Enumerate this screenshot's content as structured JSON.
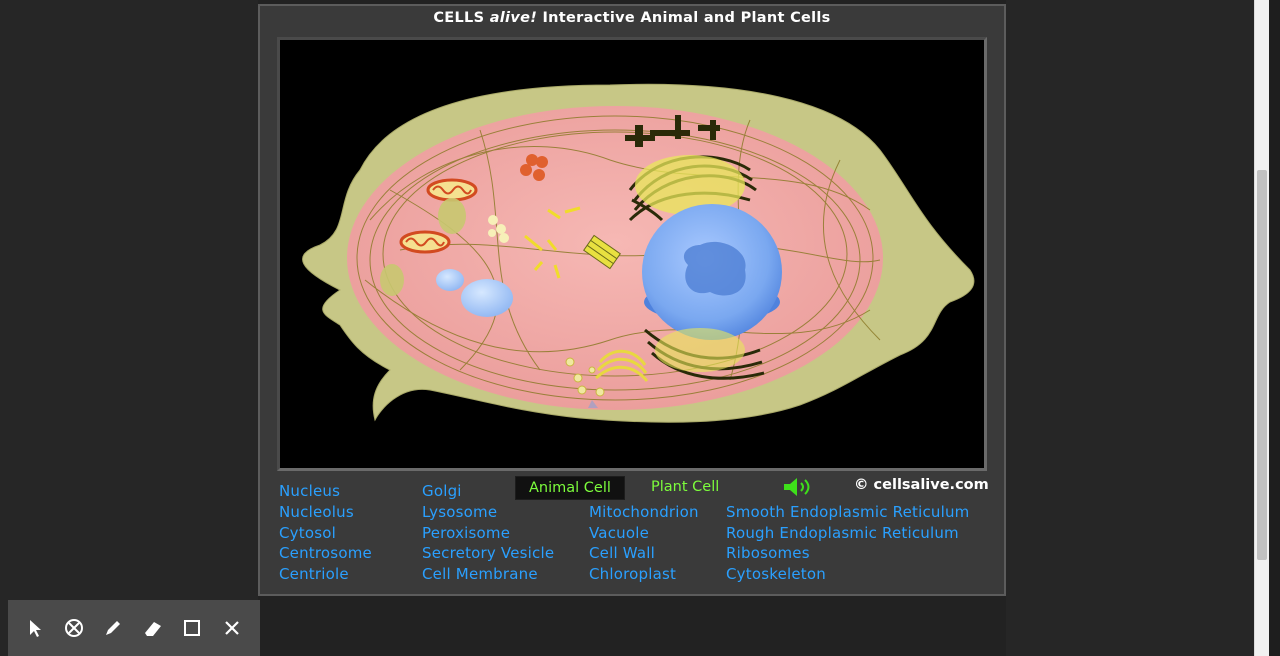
{
  "applet": {
    "title_prefix": "CELLS ",
    "title_italic": "alive!",
    "title_suffix": " Interactive Animal and Plant Cells"
  },
  "modes": {
    "animal_label": "Animal Cell",
    "plant_label": "Plant Cell"
  },
  "credit": "© cellsalive.com",
  "organelles": {
    "col1": [
      "Nucleus",
      "Nucleolus",
      "Cytosol",
      "Centrosome",
      "Centriole"
    ],
    "col2": [
      "Golgi",
      "Lysosome",
      "Peroxisome",
      "Secretory Vesicle",
      "Cell Membrane"
    ],
    "col3": [
      "Mitochondrion",
      "Vacuole",
      "Cell Wall",
      "Chloroplast"
    ],
    "col4": [
      "Smooth Endoplasmic Reticulum",
      "Rough Endoplasmic Reticulum",
      "Ribosomes",
      "Cytoskeleton"
    ]
  },
  "toolbar_icons": [
    "pointer-icon",
    "no-entry-icon",
    "pen-icon",
    "eraser-icon",
    "square-icon",
    "close-icon"
  ],
  "colors": {
    "link": "#2aa0ff",
    "mode_active": "#7cfc3c",
    "cytoplasm": "#f2aaa8",
    "nucleus": "#7aa8f0"
  }
}
